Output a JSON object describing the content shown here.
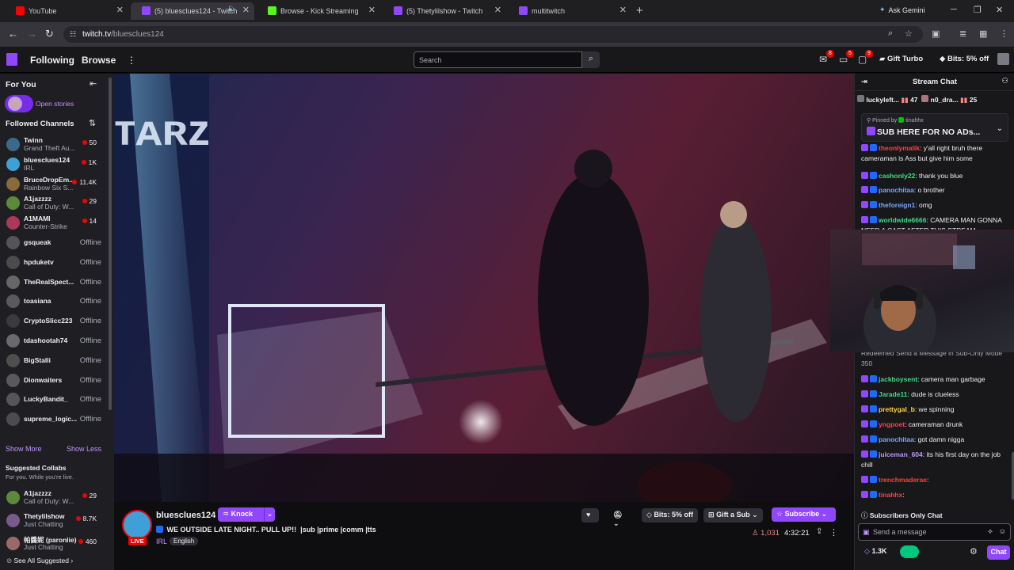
{
  "browser": {
    "tabs": [
      {
        "title": "YouTube",
        "favicon_color": "#ff0000"
      },
      {
        "title": "(5) bluesclues124 - Twitch",
        "favicon_color": "#9147ff"
      },
      {
        "title": "Browse - Kick Streaming",
        "favicon_color": "#53fc18"
      },
      {
        "title": "(5) Thetylilshow - Twitch",
        "favicon_color": "#9147ff"
      },
      {
        "title": "multitwitch",
        "favicon_color": "#9147ff"
      }
    ],
    "gemini_label": "Ask Gemini",
    "url_domain": "twitch.tv",
    "url_path": "/bluesclues124"
  },
  "topnav": {
    "following": "Following",
    "browse": "Browse",
    "search_placeholder": "Search",
    "badges": [
      "8",
      "5",
      "9"
    ],
    "gift_turbo": "Gift Turbo",
    "bits_off": "Bits: 5% off"
  },
  "sidebar": {
    "for_you": "For You",
    "open_stories": "Open stories",
    "followed_channels": "Followed Channels",
    "channels": [
      {
        "name": "Twinn",
        "game": "Grand Theft Au...",
        "viewers": "50",
        "live": true
      },
      {
        "name": "bluesclues124",
        "game": "IRL",
        "viewers": "1K",
        "live": true
      },
      {
        "name": "BruceDropEm...",
        "game": "Rainbow Six S...",
        "viewers": "11.4K",
        "live": true
      },
      {
        "name": "A1jazzzz",
        "game": "Call of Duty: W...",
        "viewers": "29",
        "live": true
      },
      {
        "name": "A1MAMI",
        "game": "Counter-Strike",
        "viewers": "14",
        "live": true
      },
      {
        "name": "gsqueak",
        "status": "Offline"
      },
      {
        "name": "hpduketv",
        "status": "Offline"
      },
      {
        "name": "TheRealSpect...",
        "status": "Offline"
      },
      {
        "name": "toasiana",
        "status": "Offline"
      },
      {
        "name": "CryptoSlicc223",
        "status": "Offline"
      },
      {
        "name": "tdashootah74",
        "status": "Offline"
      },
      {
        "name": "BigStalli",
        "status": "Offline"
      },
      {
        "name": "Dionwaiters",
        "status": "Offline"
      },
      {
        "name": "LuckyBandit_",
        "status": "Offline"
      },
      {
        "name": "supreme_logic...",
        "status": "Offline"
      }
    ],
    "show_more": "Show More",
    "show_less": "Show Less",
    "suggested_title": "Suggested Collabs",
    "suggested_sub": "For you. While you're live.",
    "suggested": [
      {
        "name": "A1jazzzz",
        "game": "Call of Duty: W...",
        "viewers": "29"
      },
      {
        "name": "Thetylilshow",
        "game": "Just Chatting",
        "viewers": "8.7K"
      },
      {
        "name": "帕醬妮 (paronlie)",
        "game": "Just Chatting",
        "viewers": "460"
      }
    ],
    "see_all": "See All Suggested"
  },
  "stream": {
    "channel": "bluesclues124",
    "knock": "Knock",
    "live": "LIVE",
    "title": "WE OUTSIDE LATE NIGHT.. PULL UP!!  |sub |prime |comm |tts",
    "category": "IRL",
    "language": "English",
    "bits_off": "Bits: 5% off",
    "gift_sub": "Gift a Sub",
    "subscribe": "Subscribe",
    "viewers": "1,031",
    "uptime": "4:32:21"
  },
  "chat": {
    "header": "Stream Chat",
    "leaderboard": [
      {
        "name": "luckyleft...",
        "count": "47"
      },
      {
        "name": "n0_dra...",
        "count": "25"
      }
    ],
    "pinned_by": "Pinned by",
    "pinned_user": "tinahhx",
    "pinned_message": "SUB HERE FOR NO ADs...",
    "messages": [
      {
        "user": "theonlymalik",
        "color": "#ff4040",
        "text": ": y'all right bruh there cameraman is Ass but give him some"
      },
      {
        "user": "cashonly22",
        "color": "#3ddc84",
        "text": ": thank you blue"
      },
      {
        "user": "panochitaa",
        "color": "#7aa7ff",
        "text": ": o brother"
      },
      {
        "user": "theforeign1",
        "color": "#7aa7ff",
        "text": ": omg"
      },
      {
        "user": "worldwide6666",
        "color": "#3ddc84",
        "text": ": CAMERA MAN GONNA NEED A CAST AFTER THIS STREAM"
      },
      {
        "user": "",
        "color": "#efeff1",
        "text": "Redeemed Send a Message in Sub-Only Mode  350"
      },
      {
        "user": "jackboysent",
        "color": "#3ddc84",
        "text": ": camera man garbage"
      },
      {
        "user": "Jarade11",
        "color": "#3ddc84",
        "text": ": dude is clueless"
      },
      {
        "user": "prettygal_b",
        "color": "#ffd24a",
        "text": ": we spinning"
      },
      {
        "user": "yngpoet",
        "color": "#ff4040",
        "text": ": cameraman drunk"
      },
      {
        "user": "panochitaa",
        "color": "#7aa7ff",
        "text": ": got damn nigga"
      },
      {
        "user": "juiceman_604",
        "color": "#bf94ff",
        "text": ": its his first day on the job chill"
      },
      {
        "user": "trenchmaderae",
        "color": "#ff4040",
        "text": ":"
      },
      {
        "user": "tinahhx",
        "color": "#ff4040",
        "text": ":"
      }
    ],
    "subscribers_only": "Subscribers Only Chat",
    "send_placeholder": "Send a message",
    "points": "1.3K",
    "chat_button": "Chat"
  },
  "colors": {
    "accent": "#9147ff",
    "live_red": "#eb0400",
    "background": "#0e0e10"
  }
}
